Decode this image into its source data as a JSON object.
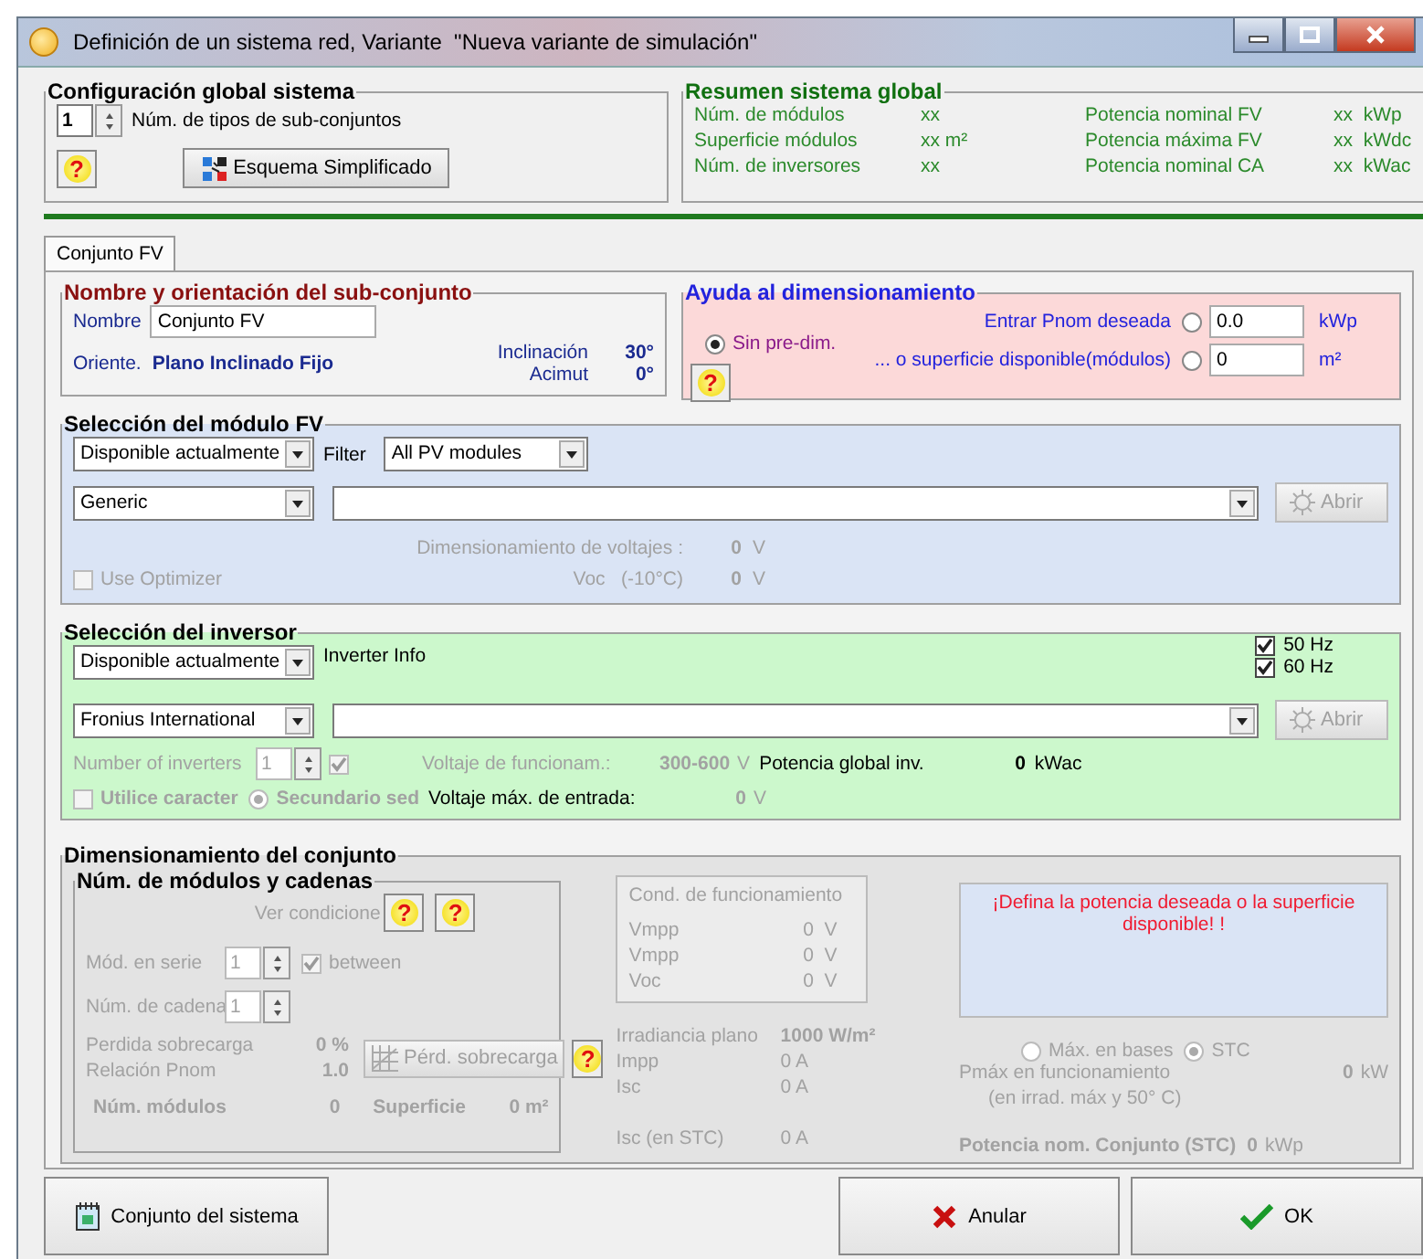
{
  "window": {
    "title": "Definición de un sistema red, Variante  \"Nueva variante de simulación\""
  },
  "global_config": {
    "title": "Configuración global sistema",
    "subarray_count": "1",
    "subarray_count_label": "Núm. de tipos de sub-conjuntos",
    "help": "?",
    "schema_button": "Esquema Simplificado"
  },
  "summary": {
    "title": "Resumen sistema global",
    "rows": [
      {
        "label": "Núm. de módulos",
        "value": "xx",
        "label_2": "Potencia nominal FV",
        "value_2": "xx  kWp"
      },
      {
        "label": "Superficie módulos",
        "value": "xx m²",
        "label_2": "Potencia máxima FV",
        "value_2": "xx  kWdc"
      },
      {
        "label": "Núm. de inversores",
        "value": "xx",
        "label_2": "Potencia nominal CA",
        "value_2": "xx  kWac"
      }
    ]
  },
  "tabs": [
    {
      "label": "Conjunto FV",
      "selected": true
    }
  ],
  "orientation": {
    "title": "Nombre y orientación del sub-conjunto",
    "name_label": "Nombre",
    "name": "Conjunto FV",
    "orient_label": "Oriente.",
    "orient": "Plano Inclinado Fijo",
    "tilt_label": "Inclinación",
    "tilt": "30°",
    "azimuth_label": "Acimut",
    "azimuth": "0°"
  },
  "sizing_aid": {
    "title": "Ayuda al dimensionamiento",
    "help": "?",
    "options": [
      {
        "kind": "plain",
        "label": "Sin pre-dim.",
        "selected": true
      },
      {
        "kind": "input",
        "label": "Entrar Pnom deseada",
        "selected": false,
        "value": "0.0",
        "unit": "kWp"
      },
      {
        "kind": "input",
        "label": "...  o superficie disponible(módulos)",
        "selected": false,
        "value": "0",
        "unit": "m²"
      }
    ]
  },
  "module": {
    "title": "Selección del módulo FV",
    "availability": "Disponible actualmente",
    "filter_label": "Filter",
    "filter": "All PV modules",
    "manufacturer": "Generic",
    "open_button": {
      "label": "Abrir",
      "disabled": true
    },
    "voltage_label": "Dimensionamiento de voltajes :",
    "voltage": "0",
    "voltage_unit": "V",
    "voc_label": "Voc   (-10°C)",
    "voc": "0",
    "voc_unit": "V",
    "optimizer": {
      "label": "Use Optimizer",
      "checked": false,
      "disabled": true
    }
  },
  "inverter": {
    "title": "Selección del inversor",
    "availability": "Disponible actualmente",
    "info_label": "Inverter Info",
    "frequencies": [
      {
        "label": "50 Hz",
        "checked": true
      },
      {
        "label": "60 Hz",
        "checked": true
      }
    ],
    "manufacturer": "Fronius International",
    "open_button": {
      "label": "Abrir",
      "disabled": true
    },
    "count_label": "Number of inverters",
    "count": "1",
    "count_check": {
      "checked": true,
      "disabled": true
    },
    "op_voltage_label": "Voltaje de funcionam.:",
    "op_voltage": "300-600",
    "op_voltage_unit": "V",
    "power_label": "Potencia global inv.",
    "power": "0",
    "power_unit": "kWac",
    "use_char": {
      "label": "Utilice caracter",
      "checked": false,
      "disabled": true
    },
    "secondary": {
      "label": "Secundario sed",
      "selected": true,
      "disabled": true
    },
    "max_voltage_label": "Voltaje máx. de entrada:",
    "max_voltage": "0",
    "max_voltage_unit": "V"
  },
  "array_sizing": {
    "title": "Dimensionamiento del conjunto",
    "strings": {
      "title": "Núm. de módulos y cadenas",
      "conditions_label": "Ver condicione",
      "help_1": "?",
      "help_2": "?",
      "series_label": "Mód. en serie",
      "series": "1",
      "between": {
        "label": "between",
        "checked": true
      },
      "strings_label": "Núm. de cadena",
      "strings": "1",
      "overload_label": "Perdida sobrecarga",
      "overload": "0 %",
      "ratio_label": "Relación Pnom",
      "ratio": "1.0",
      "overload_button": "Pérd. sobrecarga",
      "help_3": "?",
      "modules_label": "Núm. módulos",
      "modules": "0",
      "area_label": "Superficie",
      "area": "0 m²"
    },
    "conditions": {
      "title": "Cond. de funcionamiento",
      "rows": [
        {
          "label": "Vmpp",
          "value": "0  V"
        },
        {
          "label": "Vmpp",
          "value": "0  V"
        },
        {
          "label": "Voc",
          "value": "0  V"
        }
      ]
    },
    "irradiance_label": "Irradiancia plano",
    "irradiance": "1000 W/m²",
    "impp_label": "Impp",
    "impp": "0 A",
    "isc_label": "Isc",
    "isc": "0 A",
    "isc_stc_label": "Isc (en STC)",
    "isc_stc": "0 A",
    "warning": "¡Defina la potencia deseada o la superficie disponible! !",
    "power_basis": [
      {
        "label": "Máx. en bases",
        "selected": false
      },
      {
        "label": "STC",
        "selected": true
      }
    ],
    "pmax_label": "Pmáx en funcionamiento",
    "pmax_note": "(en irrad. máx y 50° C)",
    "pmax": "0",
    "pmax_unit": "kW",
    "nominal_label": "Potencia nom. Conjunto (STC)",
    "nominal": "0",
    "nominal_unit": "kWp"
  },
  "footer": {
    "buttons": [
      {
        "label": "Conjunto del sistema",
        "kind": "system"
      },
      {
        "label": "Anular",
        "kind": "cancel"
      },
      {
        "label": "OK",
        "kind": "ok"
      }
    ]
  }
}
